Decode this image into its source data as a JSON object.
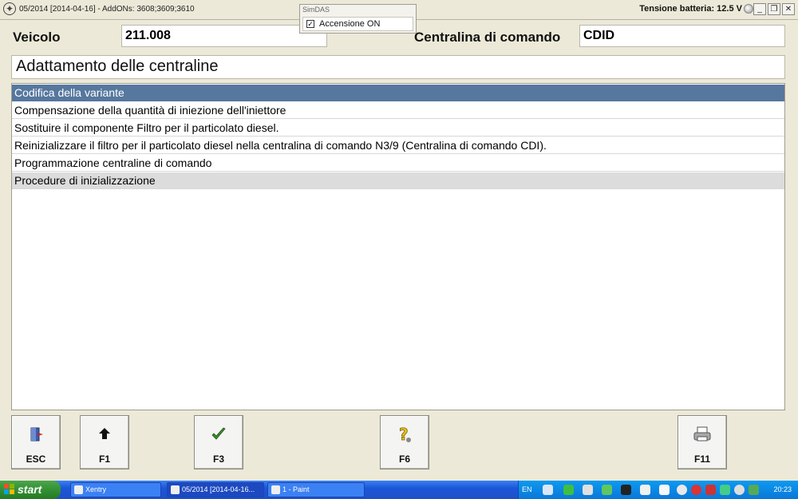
{
  "window": {
    "title": "05/2014 [2014-04-16] - AddONs: 3608;3609;3610",
    "battery_text": "Tensione batteria: 12.5 V"
  },
  "simdas": {
    "caption": "SimDAS",
    "checkbox_label": "Accensione ON",
    "checked": true
  },
  "header": {
    "vehicle_label": "Veicolo",
    "vehicle_value": "211.008",
    "ecu_label": "Centralina di comando",
    "ecu_value": "CDID"
  },
  "section_title": "Adattamento delle centraline",
  "menu_items": [
    {
      "label": "Codifica della variante",
      "state": "selected"
    },
    {
      "label": "Compensazione della quantità di iniezione dell'iniettore",
      "state": "normal"
    },
    {
      "label": "Sostituire il componente Filtro per il particolato diesel.",
      "state": "normal"
    },
    {
      "label": "Reinizializzare il filtro per il particolato diesel nella centralina di comando N3/9 (Centralina di comando CDI).",
      "state": "normal"
    },
    {
      "label": "Programmazione centraline di comando",
      "state": "normal"
    },
    {
      "label": "Procedure di inizializzazione",
      "state": "grey"
    }
  ],
  "function_keys": [
    {
      "label": "ESC",
      "icon": "exit-door-icon"
    },
    {
      "label": "F1",
      "icon": "up-arrow-icon"
    },
    {
      "label": "F3",
      "icon": "checkmark-icon"
    },
    {
      "label": "F6",
      "icon": "help-question-icon"
    },
    {
      "label": "F11",
      "icon": "printer-icon"
    }
  ],
  "taskbar": {
    "start_label": "start",
    "tasks": [
      "Xentry",
      "05/2014 [2014-04-16...",
      "1 - Paint"
    ],
    "language": "EN",
    "clock": "20:23"
  },
  "colors": {
    "selected_row": "#56779e",
    "window_bg": "#ece9d8",
    "taskbar": "#1f50c8",
    "start_button": "#2f8c2f"
  }
}
